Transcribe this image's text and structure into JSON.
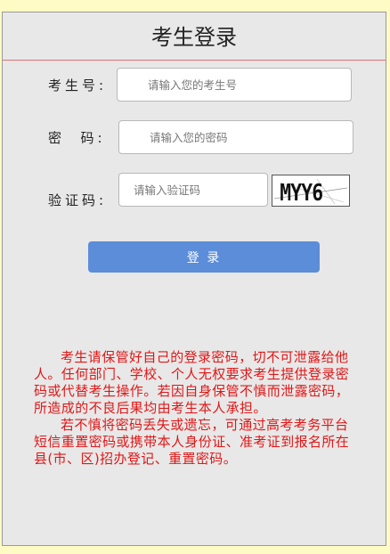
{
  "page": {
    "title": "考生登录"
  },
  "form": {
    "exam_no": {
      "label": "考生号:",
      "placeholder": "请输入您的考生号",
      "value": ""
    },
    "password": {
      "label": "密  码:",
      "placeholder": "请输入您的密码",
      "value": ""
    },
    "captcha": {
      "label": "验证码:",
      "placeholder": "请输入验证码",
      "value": "",
      "image_text": "MYY6"
    },
    "login_label": "登 录"
  },
  "notice": {
    "paragraphs": [
      "考生请保管好自己的登录密码，切不可泄露给他人。任何部门、学校、个人无权要求考生提供登录密码或代替考生操作。若因自身保管不慎而泄露密码，所造成的不良后果均由考生本人承担。",
      "若不慎将密码丢失或遗忘，可通过高考考务平台短信重置密码或携带本人身份证、准考证到报名所在县(市、区)招办登记、重置密码。"
    ]
  },
  "colors": {
    "page_bg": "#fffbc4",
    "panel_bg": "#e8e8e8",
    "title_rule": "#e07070",
    "button_bg": "#5b8dd9",
    "notice_text": "#e01818"
  }
}
